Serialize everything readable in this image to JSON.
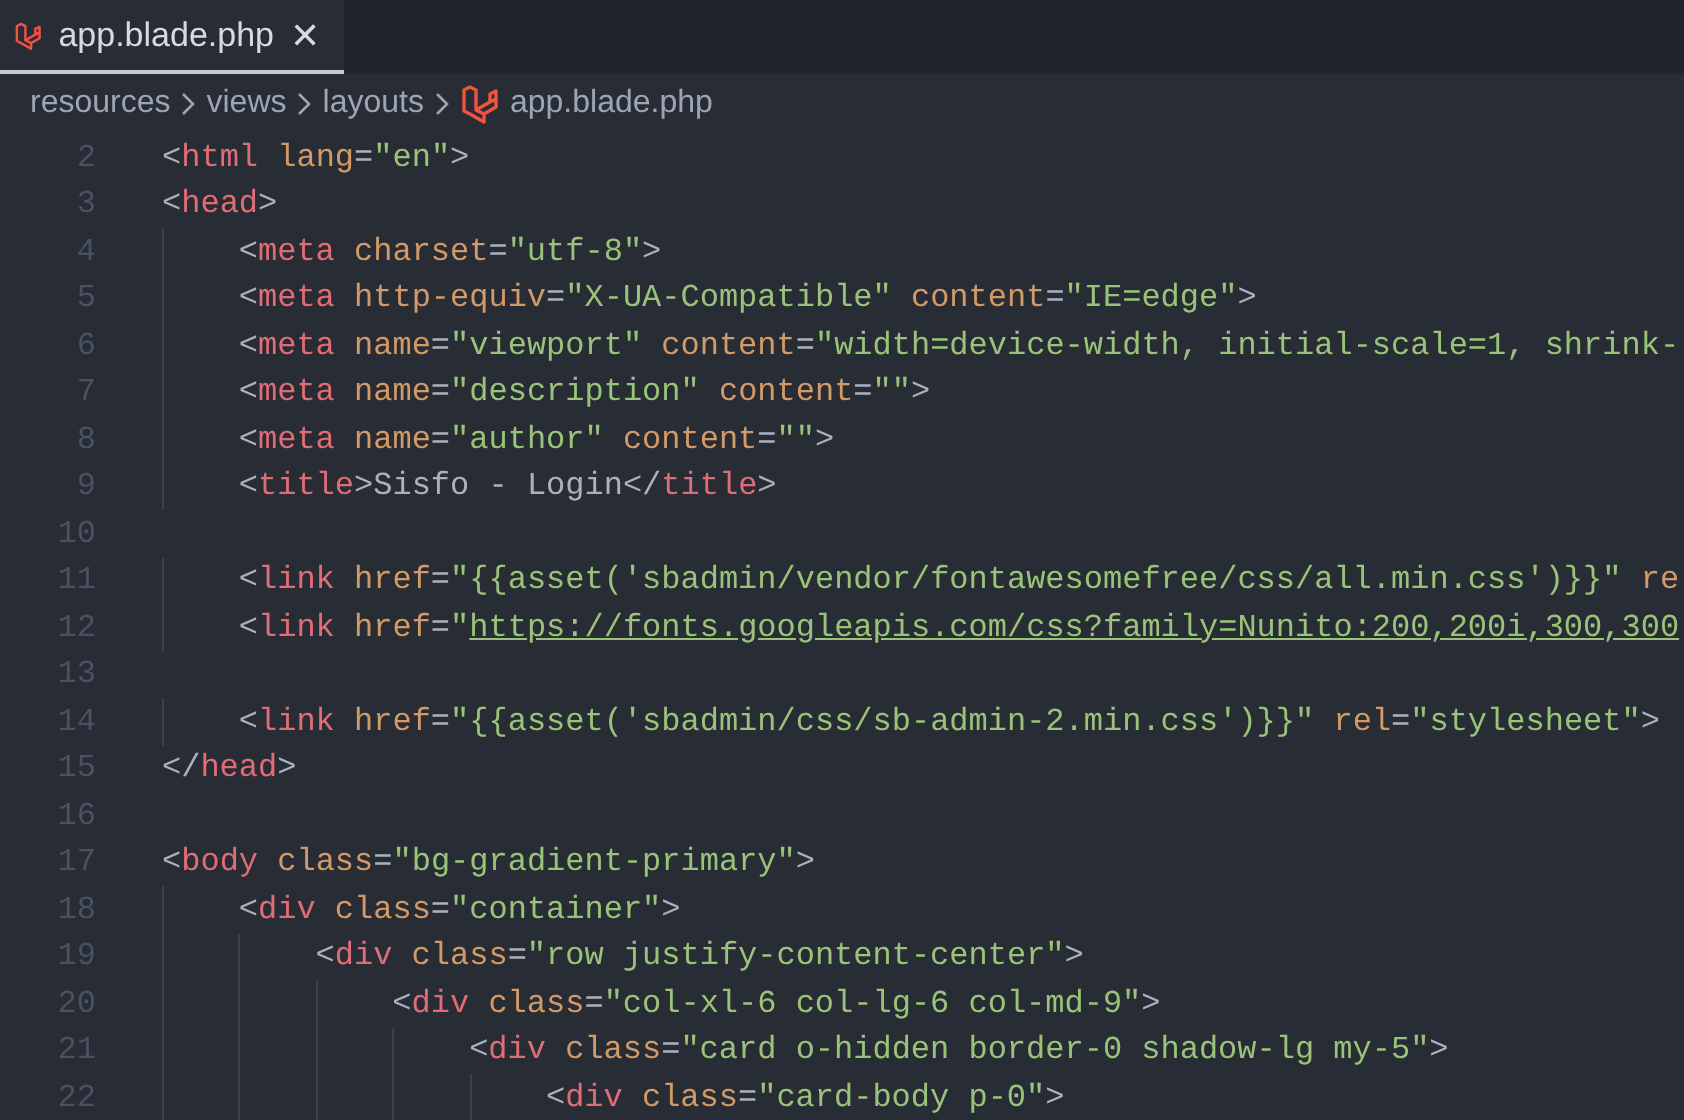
{
  "tab": {
    "label": "app.blade.php",
    "close": "✕",
    "selected": true
  },
  "breadcrumb": [
    "resources",
    "views",
    "layouts",
    "app.blade.php"
  ],
  "lines": [
    {
      "number": "2",
      "tokens": [
        {
          "kind": "punct",
          "text": "<"
        },
        {
          "kind": "tag",
          "text": "html"
        },
        {
          "kind": "attr",
          "text": " lang"
        },
        {
          "kind": "punct",
          "text": "="
        },
        {
          "kind": "string",
          "text": "\"en\""
        },
        {
          "kind": "punct",
          "text": ">"
        }
      ]
    },
    {
      "number": "3",
      "tokens": [
        {
          "kind": "punct",
          "text": "<"
        },
        {
          "kind": "tag",
          "text": "head"
        },
        {
          "kind": "punct",
          "text": ">"
        }
      ]
    },
    {
      "number": "4",
      "tokens": [
        {
          "kind": "punct",
          "text": "    <"
        },
        {
          "kind": "tag",
          "text": "meta"
        },
        {
          "kind": "attr",
          "text": " charset"
        },
        {
          "kind": "punct",
          "text": "="
        },
        {
          "kind": "string",
          "text": "\"utf-8\""
        },
        {
          "kind": "punct",
          "text": ">"
        }
      ]
    },
    {
      "number": "5",
      "tokens": [
        {
          "kind": "punct",
          "text": "    <"
        },
        {
          "kind": "tag",
          "text": "meta"
        },
        {
          "kind": "attr",
          "text": " http-equiv"
        },
        {
          "kind": "punct",
          "text": "="
        },
        {
          "kind": "string",
          "text": "\"X-UA-Compatible\""
        },
        {
          "kind": "attr",
          "text": " content"
        },
        {
          "kind": "punct",
          "text": "="
        },
        {
          "kind": "string",
          "text": "\"IE=edge\""
        },
        {
          "kind": "punct",
          "text": ">"
        }
      ]
    },
    {
      "number": "6",
      "tokens": [
        {
          "kind": "punct",
          "text": "    <"
        },
        {
          "kind": "tag",
          "text": "meta"
        },
        {
          "kind": "attr",
          "text": " name"
        },
        {
          "kind": "punct",
          "text": "="
        },
        {
          "kind": "string",
          "text": "\"viewport\""
        },
        {
          "kind": "attr",
          "text": " content"
        },
        {
          "kind": "punct",
          "text": "="
        },
        {
          "kind": "string",
          "text": "\"width=device-width, initial-scale=1, shrink-"
        }
      ]
    },
    {
      "number": "7",
      "tokens": [
        {
          "kind": "punct",
          "text": "    <"
        },
        {
          "kind": "tag",
          "text": "meta"
        },
        {
          "kind": "attr",
          "text": " name"
        },
        {
          "kind": "punct",
          "text": "="
        },
        {
          "kind": "string",
          "text": "\"description\""
        },
        {
          "kind": "attr",
          "text": " content"
        },
        {
          "kind": "punct",
          "text": "="
        },
        {
          "kind": "string",
          "text": "\"\""
        },
        {
          "kind": "punct",
          "text": ">"
        }
      ]
    },
    {
      "number": "8",
      "tokens": [
        {
          "kind": "punct",
          "text": "    <"
        },
        {
          "kind": "tag",
          "text": "meta"
        },
        {
          "kind": "attr",
          "text": " name"
        },
        {
          "kind": "punct",
          "text": "="
        },
        {
          "kind": "string",
          "text": "\"author\""
        },
        {
          "kind": "attr",
          "text": " content"
        },
        {
          "kind": "punct",
          "text": "="
        },
        {
          "kind": "string",
          "text": "\"\""
        },
        {
          "kind": "punct",
          "text": ">"
        }
      ]
    },
    {
      "number": "9",
      "tokens": [
        {
          "kind": "punct",
          "text": "    <"
        },
        {
          "kind": "tag",
          "text": "title"
        },
        {
          "kind": "punct",
          "text": ">"
        },
        {
          "kind": "text",
          "text": "Sisfo - Login"
        },
        {
          "kind": "punct",
          "text": "</"
        },
        {
          "kind": "tag",
          "text": "title"
        },
        {
          "kind": "punct",
          "text": ">"
        }
      ]
    },
    {
      "number": "10"
    },
    {
      "number": "11",
      "tokens": [
        {
          "kind": "punct",
          "text": "    <"
        },
        {
          "kind": "tag",
          "text": "link"
        },
        {
          "kind": "attr",
          "text": " href"
        },
        {
          "kind": "punct",
          "text": "="
        },
        {
          "kind": "string",
          "text": "\"{{asset('sbadmin/vendor/fontawesomefree/css/all.min.css')}}\""
        },
        {
          "kind": "attr",
          "text": " re"
        }
      ]
    },
    {
      "number": "12",
      "tokens": [
        {
          "kind": "punct",
          "text": "    <"
        },
        {
          "kind": "tag",
          "text": "link"
        },
        {
          "kind": "attr",
          "text": " href"
        },
        {
          "kind": "punct",
          "text": "="
        },
        {
          "kind": "string",
          "text": "\""
        },
        {
          "kind": "link",
          "text": "https://fonts.googleapis.com/css?family=Nunito:200,200i,300,300"
        }
      ]
    },
    {
      "number": "13"
    },
    {
      "number": "14",
      "tokens": [
        {
          "kind": "punct",
          "text": "    <"
        },
        {
          "kind": "tag",
          "text": "link"
        },
        {
          "kind": "attr",
          "text": " href"
        },
        {
          "kind": "punct",
          "text": "="
        },
        {
          "kind": "string",
          "text": "\"{{asset('sbadmin/css/sb-admin-2.min.css')}}\""
        },
        {
          "kind": "attr",
          "text": " rel"
        },
        {
          "kind": "punct",
          "text": "="
        },
        {
          "kind": "string",
          "text": "\"stylesheet\""
        },
        {
          "kind": "punct",
          "text": ">"
        }
      ]
    },
    {
      "number": "15",
      "tokens": [
        {
          "kind": "punct",
          "text": "</"
        },
        {
          "kind": "tag",
          "text": "head"
        },
        {
          "kind": "punct",
          "text": ">"
        }
      ]
    },
    {
      "number": "16"
    },
    {
      "number": "17",
      "tokens": [
        {
          "kind": "punct",
          "text": "<"
        },
        {
          "kind": "tag",
          "text": "body"
        },
        {
          "kind": "attr",
          "text": " class"
        },
        {
          "kind": "punct",
          "text": "="
        },
        {
          "kind": "string",
          "text": "\"bg-gradient-primary\""
        },
        {
          "kind": "punct",
          "text": ">"
        }
      ]
    },
    {
      "number": "18",
      "tokens": [
        {
          "kind": "punct",
          "text": "    <"
        },
        {
          "kind": "tag",
          "text": "div"
        },
        {
          "kind": "attr",
          "text": " class"
        },
        {
          "kind": "punct",
          "text": "="
        },
        {
          "kind": "string",
          "text": "\"container\""
        },
        {
          "kind": "punct",
          "text": ">"
        }
      ]
    },
    {
      "number": "19",
      "tokens": [
        {
          "kind": "punct",
          "text": "        <"
        },
        {
          "kind": "tag",
          "text": "div"
        },
        {
          "kind": "attr",
          "text": " class"
        },
        {
          "kind": "punct",
          "text": "="
        },
        {
          "kind": "string",
          "text": "\"row justify-content-center\""
        },
        {
          "kind": "punct",
          "text": ">"
        }
      ]
    },
    {
      "number": "20",
      "tokens": [
        {
          "kind": "punct",
          "text": "            <"
        },
        {
          "kind": "tag",
          "text": "div"
        },
        {
          "kind": "attr",
          "text": " class"
        },
        {
          "kind": "punct",
          "text": "="
        },
        {
          "kind": "string",
          "text": "\"col-xl-6 col-lg-6 col-md-9\""
        },
        {
          "kind": "punct",
          "text": ">"
        }
      ]
    },
    {
      "number": "21",
      "tokens": [
        {
          "kind": "punct",
          "text": "                <"
        },
        {
          "kind": "tag",
          "text": "div"
        },
        {
          "kind": "attr",
          "text": " class"
        },
        {
          "kind": "punct",
          "text": "="
        },
        {
          "kind": "string",
          "text": "\"card o-hidden border-0 shadow-lg my-5\""
        },
        {
          "kind": "punct",
          "text": ">"
        }
      ]
    },
    {
      "number": "22",
      "tokens": [
        {
          "kind": "punct",
          "text": "                    <"
        },
        {
          "kind": "tag",
          "text": "div"
        },
        {
          "kind": "attr",
          "text": " class"
        },
        {
          "kind": "punct",
          "text": "="
        },
        {
          "kind": "string",
          "text": "\"card-body p-0\""
        },
        {
          "kind": "punct",
          "text": ">"
        }
      ]
    }
  ]
}
